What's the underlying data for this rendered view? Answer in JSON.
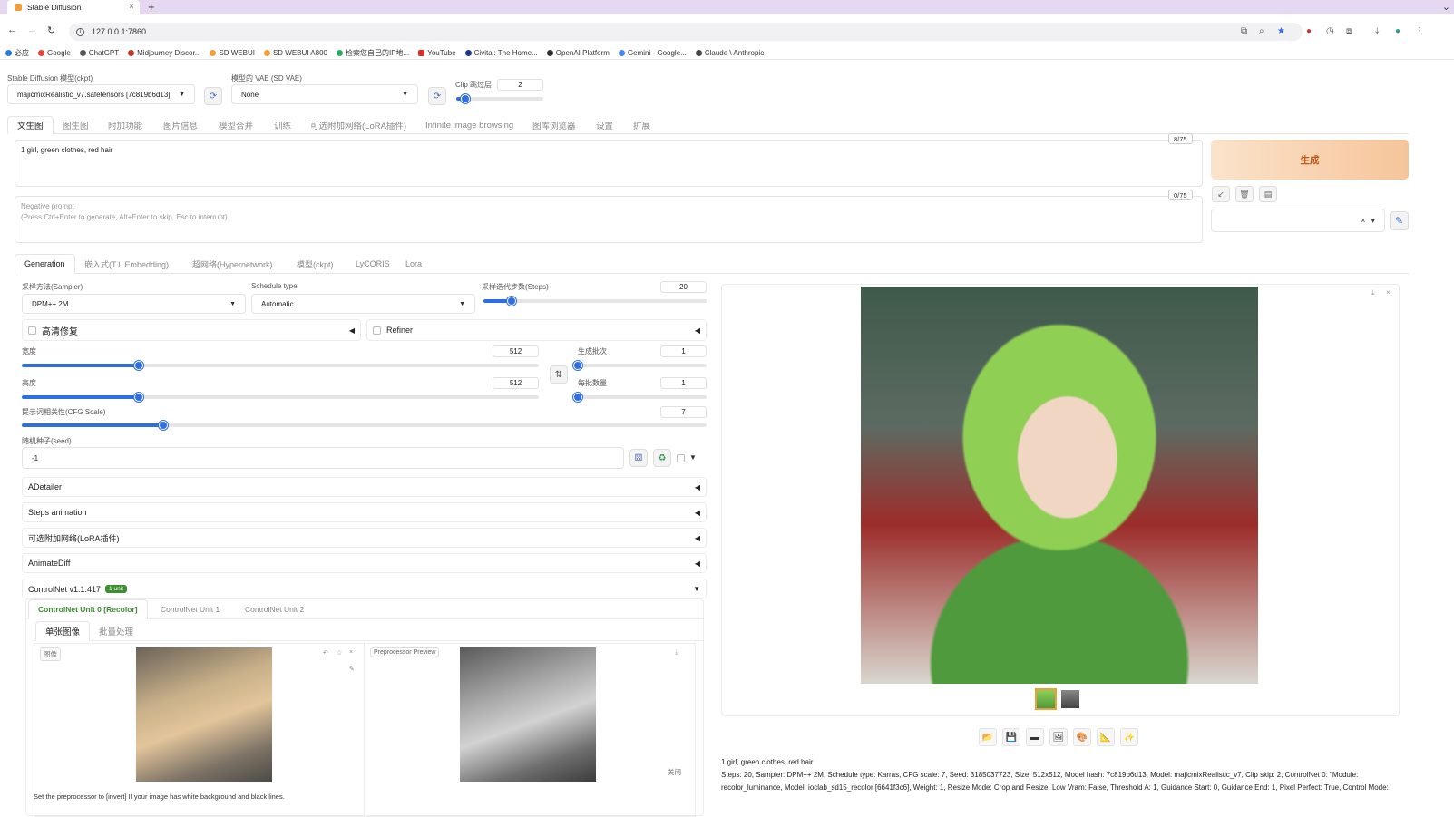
{
  "browser": {
    "tab_title": "Stable Diffusion",
    "new_tab": "+",
    "url": "127.0.0.1:7860",
    "bookmarks": [
      "必应",
      "Google",
      "ChatGPT",
      "Midjourney Discor...",
      "SD WEBUI",
      "SD WEBUI A800",
      "检索您自己的IP地...",
      "YouTube",
      "Civitai: The Home...",
      "OpenAI Platform",
      "Gemini - Google...",
      "Claude \\ Anthropic"
    ]
  },
  "top": {
    "ckpt_label": "Stable Diffusion 模型(ckpt)",
    "ckpt_value": "majicmixRealistic_v7.safetensors [7c819b6d13]",
    "vae_label": "模型的 VAE (SD VAE)",
    "vae_value": "None",
    "clip_label": "Clip 跳过层",
    "clip_value": "2",
    "clip_level": 0.1
  },
  "main_tabs": [
    "文生图",
    "图生图",
    "附加功能",
    "图片信息",
    "模型合并",
    "训练",
    "可选附加网络(LoRA插件)",
    "Infinite image browsing",
    "图库浏览器",
    "设置",
    "扩展"
  ],
  "prompt": {
    "positive": "1 girl, green clothes,  red hair",
    "positive_counter": "8/75",
    "negative_placeholder": "Negative prompt",
    "negative_hint": "(Press Ctrl+Enter to generate, Alt+Enter to skip, Esc to interrupt)",
    "negative_counter": "0/75",
    "generate_label": "生成"
  },
  "sub_tabs": [
    "Generation",
    "嵌入式(T.I. Embedding)",
    "超网络(Hypernetwork)",
    "模型(ckpt)",
    "LyCORIS",
    "Lora"
  ],
  "generation": {
    "sampler_label": "采样方法(Sampler)",
    "sampler_value": "DPM++ 2M",
    "schedule_label": "Schedule type",
    "schedule_value": "Automatic",
    "steps_label": "采样迭代步数(Steps)",
    "steps_value": "20",
    "hires_label": "高清修复",
    "refiner_label": "Refiner",
    "width_label": "宽度",
    "width_value": "512",
    "height_label": "高度",
    "height_value": "512",
    "batch_count_label": "生成批次",
    "batch_count_value": "1",
    "batch_size_label": "每批数量",
    "batch_size_value": "1",
    "cfg_label": "提示词相关性(CFG Scale)",
    "cfg_value": "7",
    "seed_label": "随机种子(seed)",
    "seed_value": "-1"
  },
  "accordions": [
    "ADetailer",
    "Steps animation",
    "可选附加网络(LoRA插件)",
    "AnimateDiff"
  ],
  "controlnet": {
    "title": "ControlNet v1.1.417",
    "badge": "1 unit",
    "units": [
      "ControlNet Unit 0 [Recolor]",
      "ControlNet Unit 1",
      "ControlNet Unit 2"
    ],
    "modes": [
      "单张图像",
      "批量处理"
    ],
    "image_label": "图像",
    "preview_label": "Preprocessor Preview",
    "close_label": "关闭",
    "hint": "Set the preprocessor to [invert] If your image has white background and black lines."
  },
  "output": {
    "prompt_line": "1 girl, green clothes, red hair",
    "params_line1": "Steps: 20, Sampler: DPM++ 2M, Schedule type: Karras, CFG scale: 7, Seed: 3185037723, Size: 512x512, Model hash: 7c819b6d13, Model: majicmixRealistic_v7, Clip skip: 2, ControlNet 0: \"Module:",
    "params_line2": "recolor_luminance, Model: ioclab_sd15_recolor [6641f3c6], Weight: 1, Resize Mode: Crop and Resize, Low Vram: False, Threshold A: 1, Guidance Start: 0, Guidance End: 1, Pixel Perfect: True, Control Mode:"
  },
  "colors": {
    "accent": "#2f6fe3",
    "generate_bg": "#f6c59a",
    "generate_text": "#c2571a",
    "active_unit": "#3b8f2f"
  }
}
